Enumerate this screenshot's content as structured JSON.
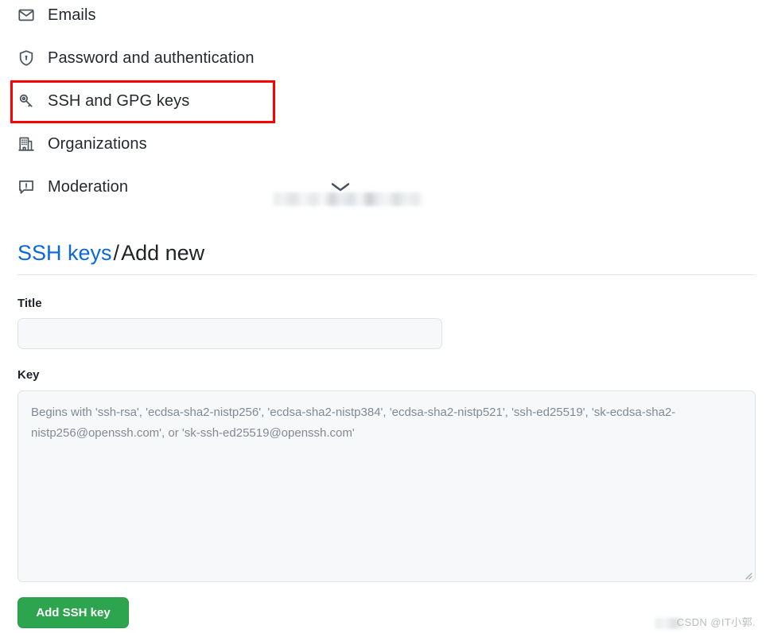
{
  "nav": {
    "items": [
      {
        "icon": "mail-icon",
        "label": "Emails"
      },
      {
        "icon": "shield-lock-icon",
        "label": "Password and authentication"
      },
      {
        "icon": "key-icon",
        "label": "SSH and GPG keys"
      },
      {
        "icon": "organization-icon",
        "label": "Organizations"
      },
      {
        "icon": "report-icon",
        "label": "Moderation"
      }
    ],
    "highlight_color": "#fe0000",
    "highlighted_item": "SSH and GPG keys"
  },
  "account_chunk": {
    "chevron_icon": "chevron-down-icon",
    "redacted": true
  },
  "heading": {
    "link_text": "SSH keys",
    "separator": "/",
    "current": "Add new",
    "link_color": "#0969da"
  },
  "form": {
    "title_label": "Title",
    "title_value": "",
    "title_placeholder": "",
    "key_label": "Key",
    "key_value": "",
    "key_placeholder": "Begins with 'ssh-rsa', 'ecdsa-sha2-nistp256', 'ecdsa-sha2-nistp384', 'ecdsa-sha2-nistp521', 'ssh-ed25519', 'sk-ecdsa-sha2-nistp256@openssh.com', or 'sk-ssh-ed25519@openssh.com'",
    "submit_label": "Add SSH key",
    "submit_color": "#2da44e",
    "resize_handle_icon": "resize-grip-icon"
  },
  "watermark": {
    "text": "CSDN @IT小郭."
  }
}
